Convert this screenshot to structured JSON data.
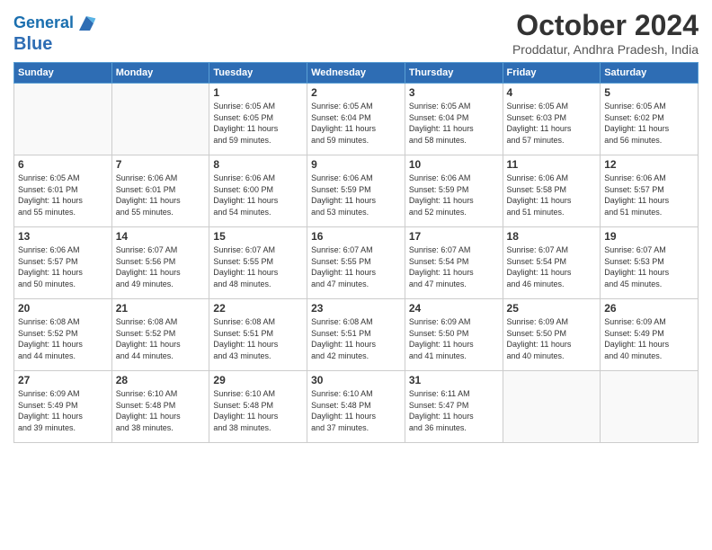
{
  "header": {
    "logo_line1": "General",
    "logo_line2": "Blue",
    "month_title": "October 2024",
    "location": "Proddatur, Andhra Pradesh, India"
  },
  "days_of_week": [
    "Sunday",
    "Monday",
    "Tuesday",
    "Wednesday",
    "Thursday",
    "Friday",
    "Saturday"
  ],
  "weeks": [
    [
      {
        "day": "",
        "info": ""
      },
      {
        "day": "",
        "info": ""
      },
      {
        "day": "1",
        "info": "Sunrise: 6:05 AM\nSunset: 6:05 PM\nDaylight: 11 hours\nand 59 minutes."
      },
      {
        "day": "2",
        "info": "Sunrise: 6:05 AM\nSunset: 6:04 PM\nDaylight: 11 hours\nand 59 minutes."
      },
      {
        "day": "3",
        "info": "Sunrise: 6:05 AM\nSunset: 6:04 PM\nDaylight: 11 hours\nand 58 minutes."
      },
      {
        "day": "4",
        "info": "Sunrise: 6:05 AM\nSunset: 6:03 PM\nDaylight: 11 hours\nand 57 minutes."
      },
      {
        "day": "5",
        "info": "Sunrise: 6:05 AM\nSunset: 6:02 PM\nDaylight: 11 hours\nand 56 minutes."
      }
    ],
    [
      {
        "day": "6",
        "info": "Sunrise: 6:05 AM\nSunset: 6:01 PM\nDaylight: 11 hours\nand 55 minutes."
      },
      {
        "day": "7",
        "info": "Sunrise: 6:06 AM\nSunset: 6:01 PM\nDaylight: 11 hours\nand 55 minutes."
      },
      {
        "day": "8",
        "info": "Sunrise: 6:06 AM\nSunset: 6:00 PM\nDaylight: 11 hours\nand 54 minutes."
      },
      {
        "day": "9",
        "info": "Sunrise: 6:06 AM\nSunset: 5:59 PM\nDaylight: 11 hours\nand 53 minutes."
      },
      {
        "day": "10",
        "info": "Sunrise: 6:06 AM\nSunset: 5:59 PM\nDaylight: 11 hours\nand 52 minutes."
      },
      {
        "day": "11",
        "info": "Sunrise: 6:06 AM\nSunset: 5:58 PM\nDaylight: 11 hours\nand 51 minutes."
      },
      {
        "day": "12",
        "info": "Sunrise: 6:06 AM\nSunset: 5:57 PM\nDaylight: 11 hours\nand 51 minutes."
      }
    ],
    [
      {
        "day": "13",
        "info": "Sunrise: 6:06 AM\nSunset: 5:57 PM\nDaylight: 11 hours\nand 50 minutes."
      },
      {
        "day": "14",
        "info": "Sunrise: 6:07 AM\nSunset: 5:56 PM\nDaylight: 11 hours\nand 49 minutes."
      },
      {
        "day": "15",
        "info": "Sunrise: 6:07 AM\nSunset: 5:55 PM\nDaylight: 11 hours\nand 48 minutes."
      },
      {
        "day": "16",
        "info": "Sunrise: 6:07 AM\nSunset: 5:55 PM\nDaylight: 11 hours\nand 47 minutes."
      },
      {
        "day": "17",
        "info": "Sunrise: 6:07 AM\nSunset: 5:54 PM\nDaylight: 11 hours\nand 47 minutes."
      },
      {
        "day": "18",
        "info": "Sunrise: 6:07 AM\nSunset: 5:54 PM\nDaylight: 11 hours\nand 46 minutes."
      },
      {
        "day": "19",
        "info": "Sunrise: 6:07 AM\nSunset: 5:53 PM\nDaylight: 11 hours\nand 45 minutes."
      }
    ],
    [
      {
        "day": "20",
        "info": "Sunrise: 6:08 AM\nSunset: 5:52 PM\nDaylight: 11 hours\nand 44 minutes."
      },
      {
        "day": "21",
        "info": "Sunrise: 6:08 AM\nSunset: 5:52 PM\nDaylight: 11 hours\nand 44 minutes."
      },
      {
        "day": "22",
        "info": "Sunrise: 6:08 AM\nSunset: 5:51 PM\nDaylight: 11 hours\nand 43 minutes."
      },
      {
        "day": "23",
        "info": "Sunrise: 6:08 AM\nSunset: 5:51 PM\nDaylight: 11 hours\nand 42 minutes."
      },
      {
        "day": "24",
        "info": "Sunrise: 6:09 AM\nSunset: 5:50 PM\nDaylight: 11 hours\nand 41 minutes."
      },
      {
        "day": "25",
        "info": "Sunrise: 6:09 AM\nSunset: 5:50 PM\nDaylight: 11 hours\nand 40 minutes."
      },
      {
        "day": "26",
        "info": "Sunrise: 6:09 AM\nSunset: 5:49 PM\nDaylight: 11 hours\nand 40 minutes."
      }
    ],
    [
      {
        "day": "27",
        "info": "Sunrise: 6:09 AM\nSunset: 5:49 PM\nDaylight: 11 hours\nand 39 minutes."
      },
      {
        "day": "28",
        "info": "Sunrise: 6:10 AM\nSunset: 5:48 PM\nDaylight: 11 hours\nand 38 minutes."
      },
      {
        "day": "29",
        "info": "Sunrise: 6:10 AM\nSunset: 5:48 PM\nDaylight: 11 hours\nand 38 minutes."
      },
      {
        "day": "30",
        "info": "Sunrise: 6:10 AM\nSunset: 5:48 PM\nDaylight: 11 hours\nand 37 minutes."
      },
      {
        "day": "31",
        "info": "Sunrise: 6:11 AM\nSunset: 5:47 PM\nDaylight: 11 hours\nand 36 minutes."
      },
      {
        "day": "",
        "info": ""
      },
      {
        "day": "",
        "info": ""
      }
    ]
  ]
}
